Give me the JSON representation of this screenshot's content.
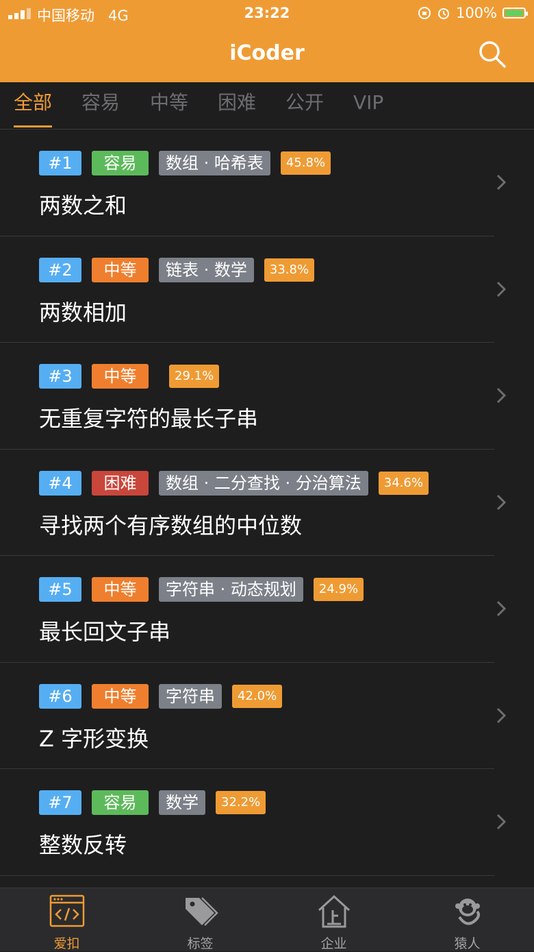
{
  "status_bar": {
    "carrier": "中国移动",
    "network": "4G",
    "time": "23:22",
    "battery": "100%"
  },
  "nav": {
    "title": "iCoder",
    "search_icon": "search-icon"
  },
  "tabs": [
    {
      "label": "全部",
      "active": true
    },
    {
      "label": "容易",
      "active": false
    },
    {
      "label": "中等",
      "active": false
    },
    {
      "label": "困难",
      "active": false
    },
    {
      "label": "公开",
      "active": false
    },
    {
      "label": "VIP",
      "active": false
    }
  ],
  "problems": [
    {
      "num": "#1",
      "difficulty": "容易",
      "level": "easy",
      "tags": "数组 · 哈希表",
      "rate": "45.8%",
      "title": "两数之和"
    },
    {
      "num": "#2",
      "difficulty": "中等",
      "level": "med",
      "tags": "链表 · 数学",
      "rate": "33.8%",
      "title": "两数相加"
    },
    {
      "num": "#3",
      "difficulty": "中等",
      "level": "med",
      "tags": "",
      "rate": "29.1%",
      "title": "无重复字符的最长子串"
    },
    {
      "num": "#4",
      "difficulty": "困难",
      "level": "hard",
      "tags": "数组 · 二分查找 · 分治算法",
      "rate": "34.6%",
      "title": "寻找两个有序数组的中位数"
    },
    {
      "num": "#5",
      "difficulty": "中等",
      "level": "med",
      "tags": "字符串 · 动态规划",
      "rate": "24.9%",
      "title": "最长回文子串"
    },
    {
      "num": "#6",
      "difficulty": "中等",
      "level": "med",
      "tags": "字符串",
      "rate": "42.0%",
      "title": "Z 字形变换"
    },
    {
      "num": "#7",
      "difficulty": "容易",
      "level": "easy",
      "tags": "数学",
      "rate": "32.2%",
      "title": "整数反转"
    }
  ],
  "tabbar": [
    {
      "label": "爱扣",
      "icon": "code-icon",
      "active": true
    },
    {
      "label": "标签",
      "icon": "tag-icon",
      "active": false
    },
    {
      "label": "企业",
      "icon": "enterprise-icon",
      "active": false
    },
    {
      "label": "猿人",
      "icon": "monkey-icon",
      "active": false
    }
  ],
  "colors": {
    "accent": "#ef9b34",
    "number_badge": "#56aef2",
    "easy": "#5dba5b",
    "medium": "#ef7f2e",
    "hard": "#c9463b",
    "tag_badge": "#7c8088",
    "background": "#1e1e1f"
  }
}
